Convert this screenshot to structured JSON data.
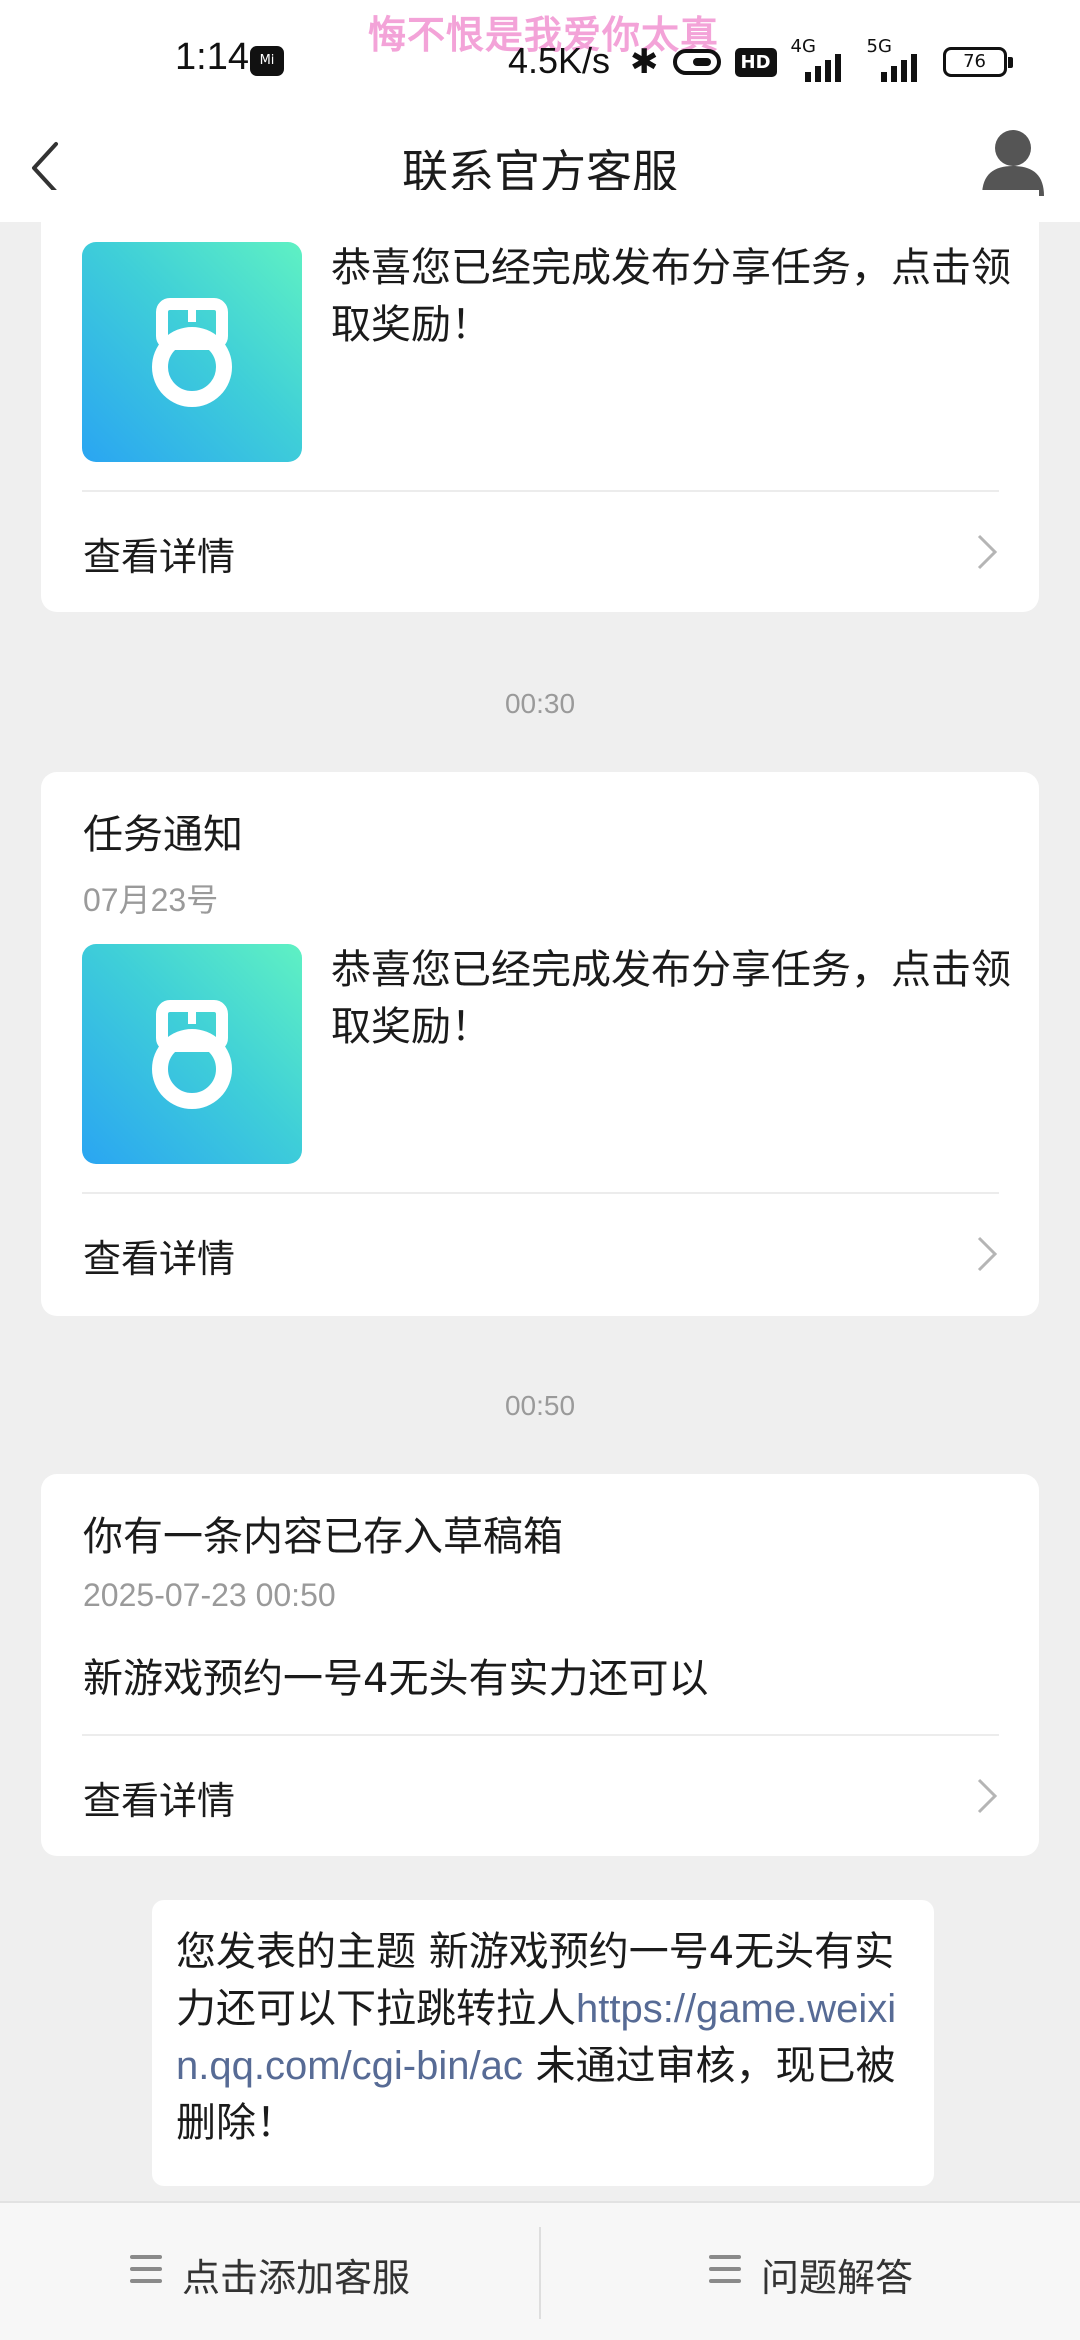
{
  "status_bar": {
    "time": "1:14",
    "marquee": "悔不恨是我爱你太真",
    "net_speed": "4.5K/s",
    "hd": "HD",
    "signal1": "4G",
    "signal2": "5G",
    "battery": "76"
  },
  "nav": {
    "title": "联系官方客服"
  },
  "cards": [
    {
      "text": "恭喜您已经完成发布分享任务，点击领取奖励！",
      "detail": "查看详情"
    },
    {
      "title": "任务通知",
      "date": "07月23号",
      "text": "恭喜您已经完成发布分享任务，点击领取奖励！",
      "detail": "查看详情"
    },
    {
      "title": "你有一条内容已存入草稿箱",
      "date": "2025-07-23 00:50",
      "body": "新游戏预约一号4无头有实力还可以",
      "detail": "查看详情"
    }
  ],
  "timestamps": [
    "00:30",
    "00:50"
  ],
  "message": {
    "prefix": "您发表的主题 新游戏预约一号4无头有实力还可以下拉跳转拉人",
    "link": "https://game.weixin.qq.com/cgi-bin/ac",
    "suffix": " 未通过审核，现已被删除！"
  },
  "bottom_bar": {
    "left_label": "点击添加客服",
    "right_label": "问题解答"
  },
  "colors": {
    "link": "#576b95",
    "thumb_gradient_start": "#5ff1c3",
    "thumb_gradient_end": "#2aa5f2",
    "background": "#efefef"
  }
}
